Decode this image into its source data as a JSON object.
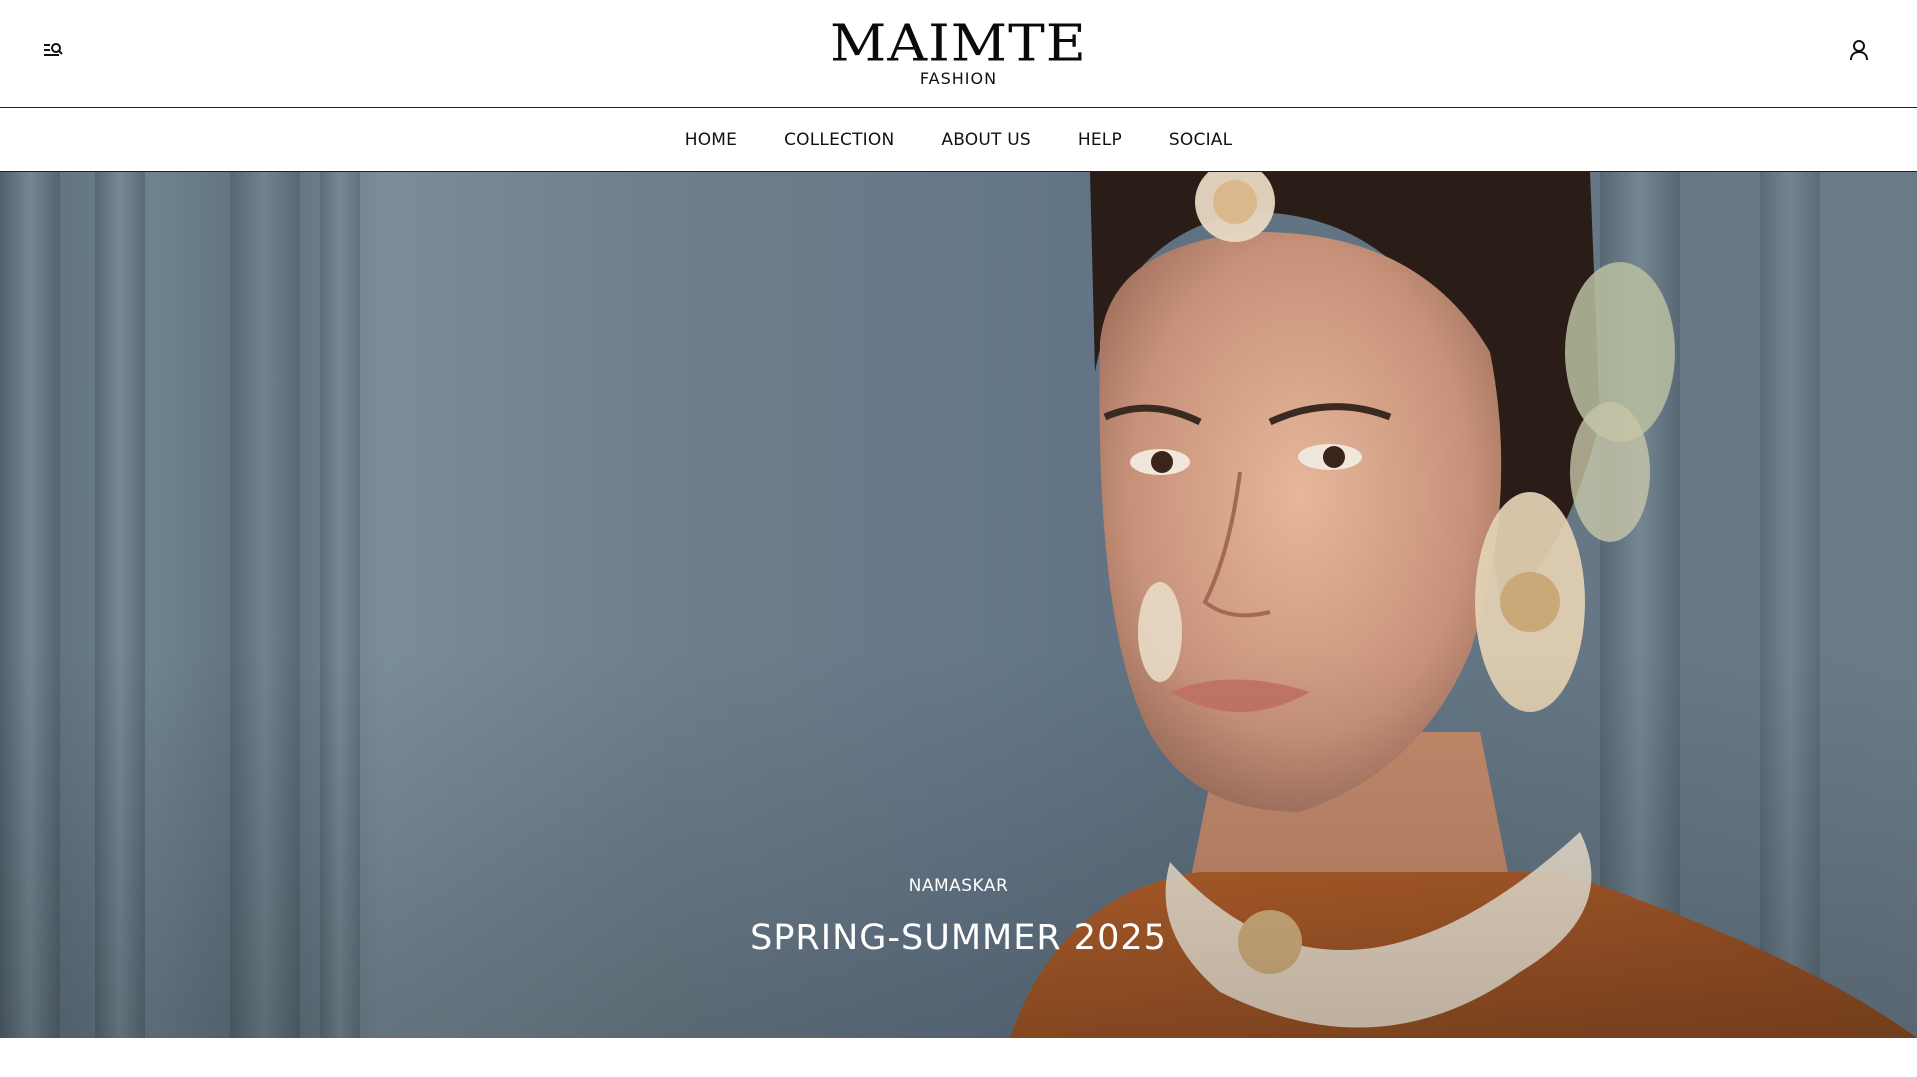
{
  "header": {
    "logo_main": "MAIMTE",
    "logo_sub": "FASHION",
    "menu_search_icon": "menu-search-icon",
    "account_icon": "user-icon"
  },
  "nav": {
    "items": [
      {
        "label": "HOME"
      },
      {
        "label": "COLLECTION"
      },
      {
        "label": "ABOUT US"
      },
      {
        "label": "HELP"
      },
      {
        "label": "SOCIAL"
      }
    ]
  },
  "hero": {
    "kicker": "NAMASKAR",
    "title": "SPRING-SUMMER 2025"
  }
}
